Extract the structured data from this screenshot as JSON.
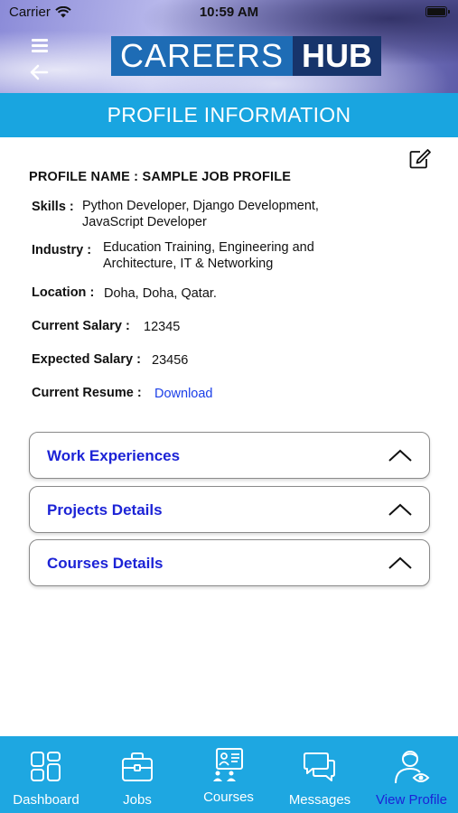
{
  "status": {
    "carrier": "Carrier",
    "time": "10:59 AM"
  },
  "header": {
    "logo_left": "CAREERS",
    "logo_right": "HUB",
    "title": "PROFILE INFORMATION"
  },
  "profile": {
    "name_line": "PROFILE NAME : SAMPLE JOB PROFILE",
    "skills_label": "Skills :",
    "skills_value": "Python Developer, Django Development,\nJavaScript Developer",
    "industry_label": "Industry :",
    "industry_value": "Education Training, Engineering and\nArchitecture, IT & Networking",
    "location_label": "Location :",
    "location_value": "Doha, Doha, Qatar.",
    "current_salary_label": "Current Salary :",
    "current_salary_value": "12345",
    "expected_salary_label": "Expected Salary :",
    "expected_salary_value": "23456",
    "resume_label": "Current Resume :",
    "resume_link": "Download"
  },
  "sections": [
    {
      "label": "Work Experiences"
    },
    {
      "label": "Projects Details"
    },
    {
      "label": "Courses Details"
    }
  ],
  "tabs": [
    {
      "label": "Dashboard",
      "icon": "dashboard-icon"
    },
    {
      "label": "Jobs",
      "icon": "briefcase-icon"
    },
    {
      "label": "Courses",
      "icon": "courses-icon"
    },
    {
      "label": "Messages",
      "icon": "messages-icon"
    },
    {
      "label": "View Profile",
      "icon": "profile-icon",
      "active": true
    }
  ],
  "colors": {
    "accent": "#19a5e0",
    "link": "#1a3ee8",
    "section_text": "#1c23d6",
    "logo_blue": "#1e6cb5",
    "logo_dark": "#17346b"
  }
}
